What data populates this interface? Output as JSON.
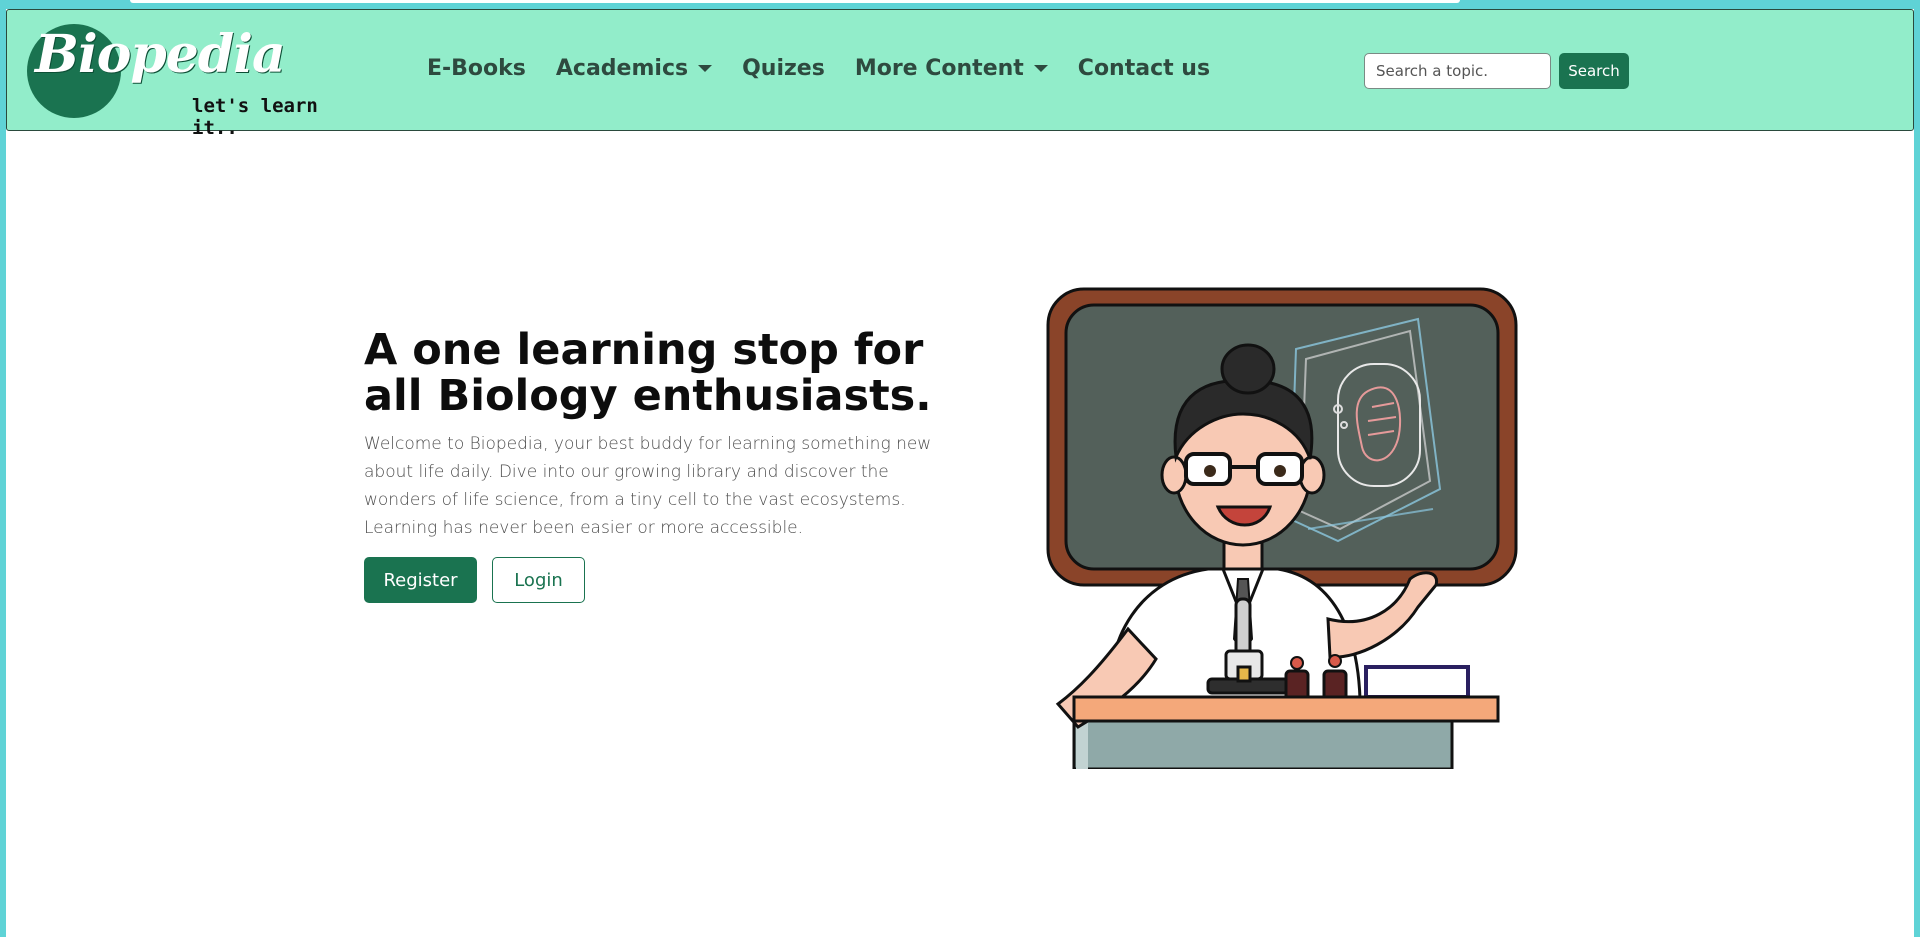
{
  "brand": {
    "name": "Biopedia",
    "tagline": "let's learn it.."
  },
  "nav": {
    "items": [
      {
        "label": "E-Books",
        "dropdown": false
      },
      {
        "label": "Academics",
        "dropdown": true
      },
      {
        "label": "Quizes",
        "dropdown": false
      },
      {
        "label": "More Content",
        "dropdown": true
      },
      {
        "label": "Contact us",
        "dropdown": false
      }
    ]
  },
  "search": {
    "placeholder": "Search a topic.",
    "value": "",
    "button_label": "Search"
  },
  "hero": {
    "title": "A one learning stop for all Biology enthusiasts.",
    "description": "Welcome to Biopedia, your best buddy for learning something new about life daily. Dive into our growing library and discover the wonders of life science, from a tiny cell to the vast ecosystems. Learning has never been easier or more accessible.",
    "register_label": "Register",
    "login_label": "Login"
  },
  "colors": {
    "navbar_bg": "#92edca",
    "brand_green": "#1a7350",
    "page_bg": "#5fd3d6"
  }
}
